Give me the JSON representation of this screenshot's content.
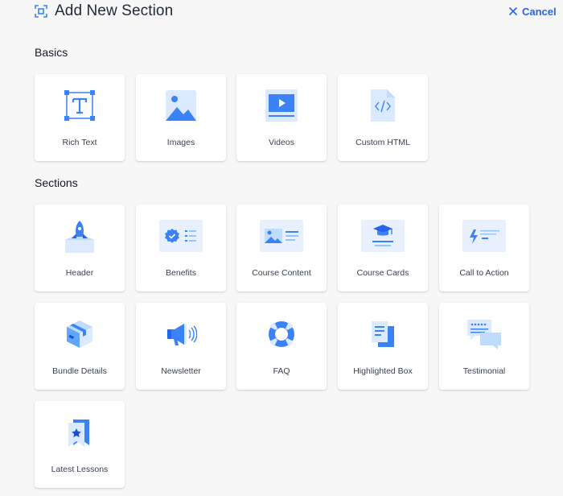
{
  "header": {
    "title": "Add New Section",
    "cancel_label": "Cancel"
  },
  "basics": {
    "heading": "Basics",
    "items": [
      {
        "label": "Rich Text",
        "icon": "rich-text-icon"
      },
      {
        "label": "Images",
        "icon": "image-icon"
      },
      {
        "label": "Videos",
        "icon": "video-icon"
      },
      {
        "label": "Custom HTML",
        "icon": "code-file-icon"
      }
    ]
  },
  "sections": {
    "heading": "Sections",
    "items": [
      {
        "label": "Header",
        "icon": "rocket-icon"
      },
      {
        "label": "Benefits",
        "icon": "badge-list-icon"
      },
      {
        "label": "Course Content",
        "icon": "image-text-icon"
      },
      {
        "label": "Course Cards",
        "icon": "graduation-cap-icon"
      },
      {
        "label": "Call to Action",
        "icon": "lightning-icon"
      },
      {
        "label": "Bundle Details",
        "icon": "box-icon"
      },
      {
        "label": "Newsletter",
        "icon": "megaphone-icon"
      },
      {
        "label": "FAQ",
        "icon": "lifebuoy-icon"
      },
      {
        "label": "Highlighted Box",
        "icon": "stacked-pages-icon"
      },
      {
        "label": "Testimonial",
        "icon": "chat-bubbles-icon"
      },
      {
        "label": "Latest Lessons",
        "icon": "bookmark-star-icon"
      }
    ]
  },
  "colors": {
    "accent": "#2563eb",
    "icon_primary": "#3b82f6",
    "icon_light": "#dbeafe",
    "background": "#f7f7f8",
    "card": "#ffffff"
  }
}
